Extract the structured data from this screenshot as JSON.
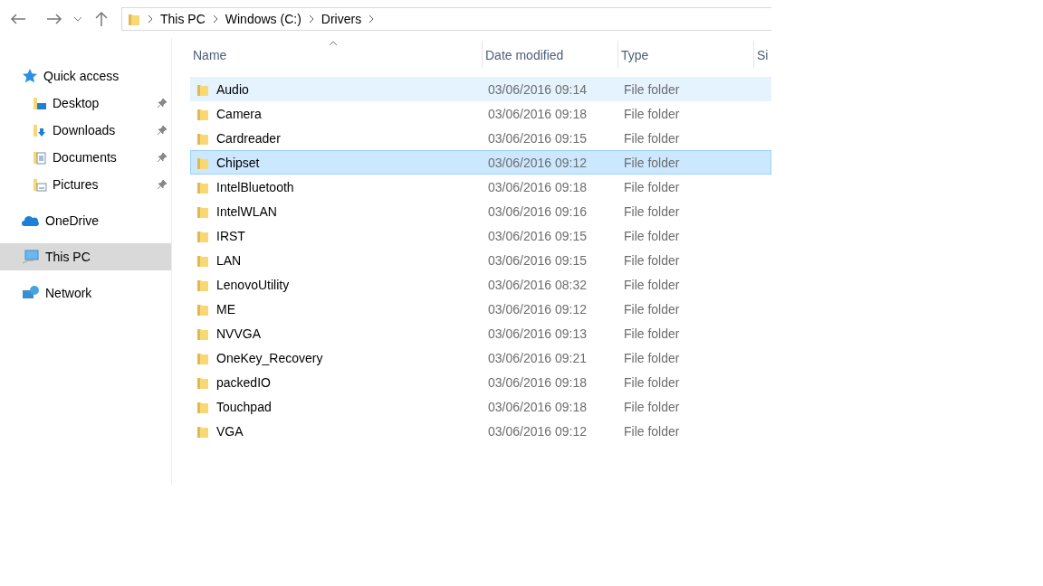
{
  "breadcrumb": [
    "This PC",
    "Windows (C:)",
    "Drivers"
  ],
  "sidebar": [
    {
      "label": "Quick access",
      "selected": false,
      "children": [
        {
          "label": "Desktop",
          "pinned": true,
          "selected": false
        },
        {
          "label": "Downloads",
          "pinned": true,
          "selected": false
        },
        {
          "label": "Documents",
          "pinned": true,
          "selected": false
        },
        {
          "label": "Pictures",
          "pinned": true,
          "selected": false
        }
      ]
    },
    {
      "label": "OneDrive",
      "selected": false
    },
    {
      "label": "This PC",
      "selected": true
    },
    {
      "label": "Network",
      "selected": false
    }
  ],
  "table": {
    "columns": [
      "Name",
      "Date modified",
      "Type",
      "Si"
    ],
    "rows": [
      {
        "name": "Audio",
        "date": "03/06/2016 09:14",
        "type": "File folder",
        "selected": false,
        "hovered": true
      },
      {
        "name": "Camera",
        "date": "03/06/2016 09:18",
        "type": "File folder",
        "selected": false,
        "hovered": false
      },
      {
        "name": "Cardreader",
        "date": "03/06/2016 09:15",
        "type": "File folder",
        "selected": false,
        "hovered": false
      },
      {
        "name": "Chipset",
        "date": "03/06/2016 09:12",
        "type": "File folder",
        "selected": true,
        "hovered": false
      },
      {
        "name": "IntelBluetooth",
        "date": "03/06/2016 09:18",
        "type": "File folder",
        "selected": false,
        "hovered": false
      },
      {
        "name": "IntelWLAN",
        "date": "03/06/2016 09:16",
        "type": "File folder",
        "selected": false,
        "hovered": false
      },
      {
        "name": "IRST",
        "date": "03/06/2016 09:15",
        "type": "File folder",
        "selected": false,
        "hovered": false
      },
      {
        "name": "LAN",
        "date": "03/06/2016 09:15",
        "type": "File folder",
        "selected": false,
        "hovered": false
      },
      {
        "name": "LenovoUtility",
        "date": "03/06/2016 08:32",
        "type": "File folder",
        "selected": false,
        "hovered": false
      },
      {
        "name": "ME",
        "date": "03/06/2016 09:12",
        "type": "File folder",
        "selected": false,
        "hovered": false
      },
      {
        "name": "NVVGA",
        "date": "03/06/2016 09:13",
        "type": "File folder",
        "selected": false,
        "hovered": false
      },
      {
        "name": "OneKey_Recovery",
        "date": "03/06/2016 09:21",
        "type": "File folder",
        "selected": false,
        "hovered": false
      },
      {
        "name": "packedIO",
        "date": "03/06/2016 09:18",
        "type": "File folder",
        "selected": false,
        "hovered": false
      },
      {
        "name": "Touchpad",
        "date": "03/06/2016 09:18",
        "type": "File folder",
        "selected": false,
        "hovered": false
      },
      {
        "name": "VGA",
        "date": "03/06/2016 09:12",
        "type": "File folder",
        "selected": false,
        "hovered": false
      }
    ]
  }
}
